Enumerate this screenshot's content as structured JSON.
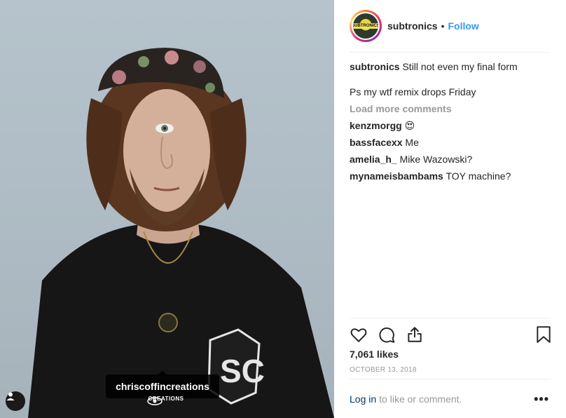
{
  "post": {
    "username": "subtronics",
    "follow_label": "Follow",
    "separator": "•",
    "avatar_text": "SUBTRONICS"
  },
  "photo": {
    "tag_label": "chriscoffincreations",
    "watermark_text": "CREATIONS",
    "user_tag_icon": "person-icon"
  },
  "caption": {
    "username": "subtronics",
    "text": "Still not even my final form",
    "extra": "Ps my wtf remix drops Friday"
  },
  "load_more_label": "Load more comments",
  "comments": [
    {
      "user": "kenzmorgg",
      "text": "😍"
    },
    {
      "user": "bassfacexx",
      "text": "Me"
    },
    {
      "user": "amelia_h_",
      "text": "Mike Wazowski?"
    },
    {
      "user": "mynameisbambams",
      "text": "TOY machine?"
    }
  ],
  "actions": {
    "icons": [
      "heart-icon",
      "comment-icon",
      "share-icon",
      "bookmark-icon"
    ]
  },
  "likes": "7,061 likes",
  "date": "OCTOBER 13, 2018",
  "footer": {
    "login_label": "Log in",
    "login_rest": "to like or comment.",
    "more_label": "•••"
  },
  "colors": {
    "link_blue": "#3897f0",
    "muted_gray": "#999999",
    "text_dark": "#262626"
  }
}
